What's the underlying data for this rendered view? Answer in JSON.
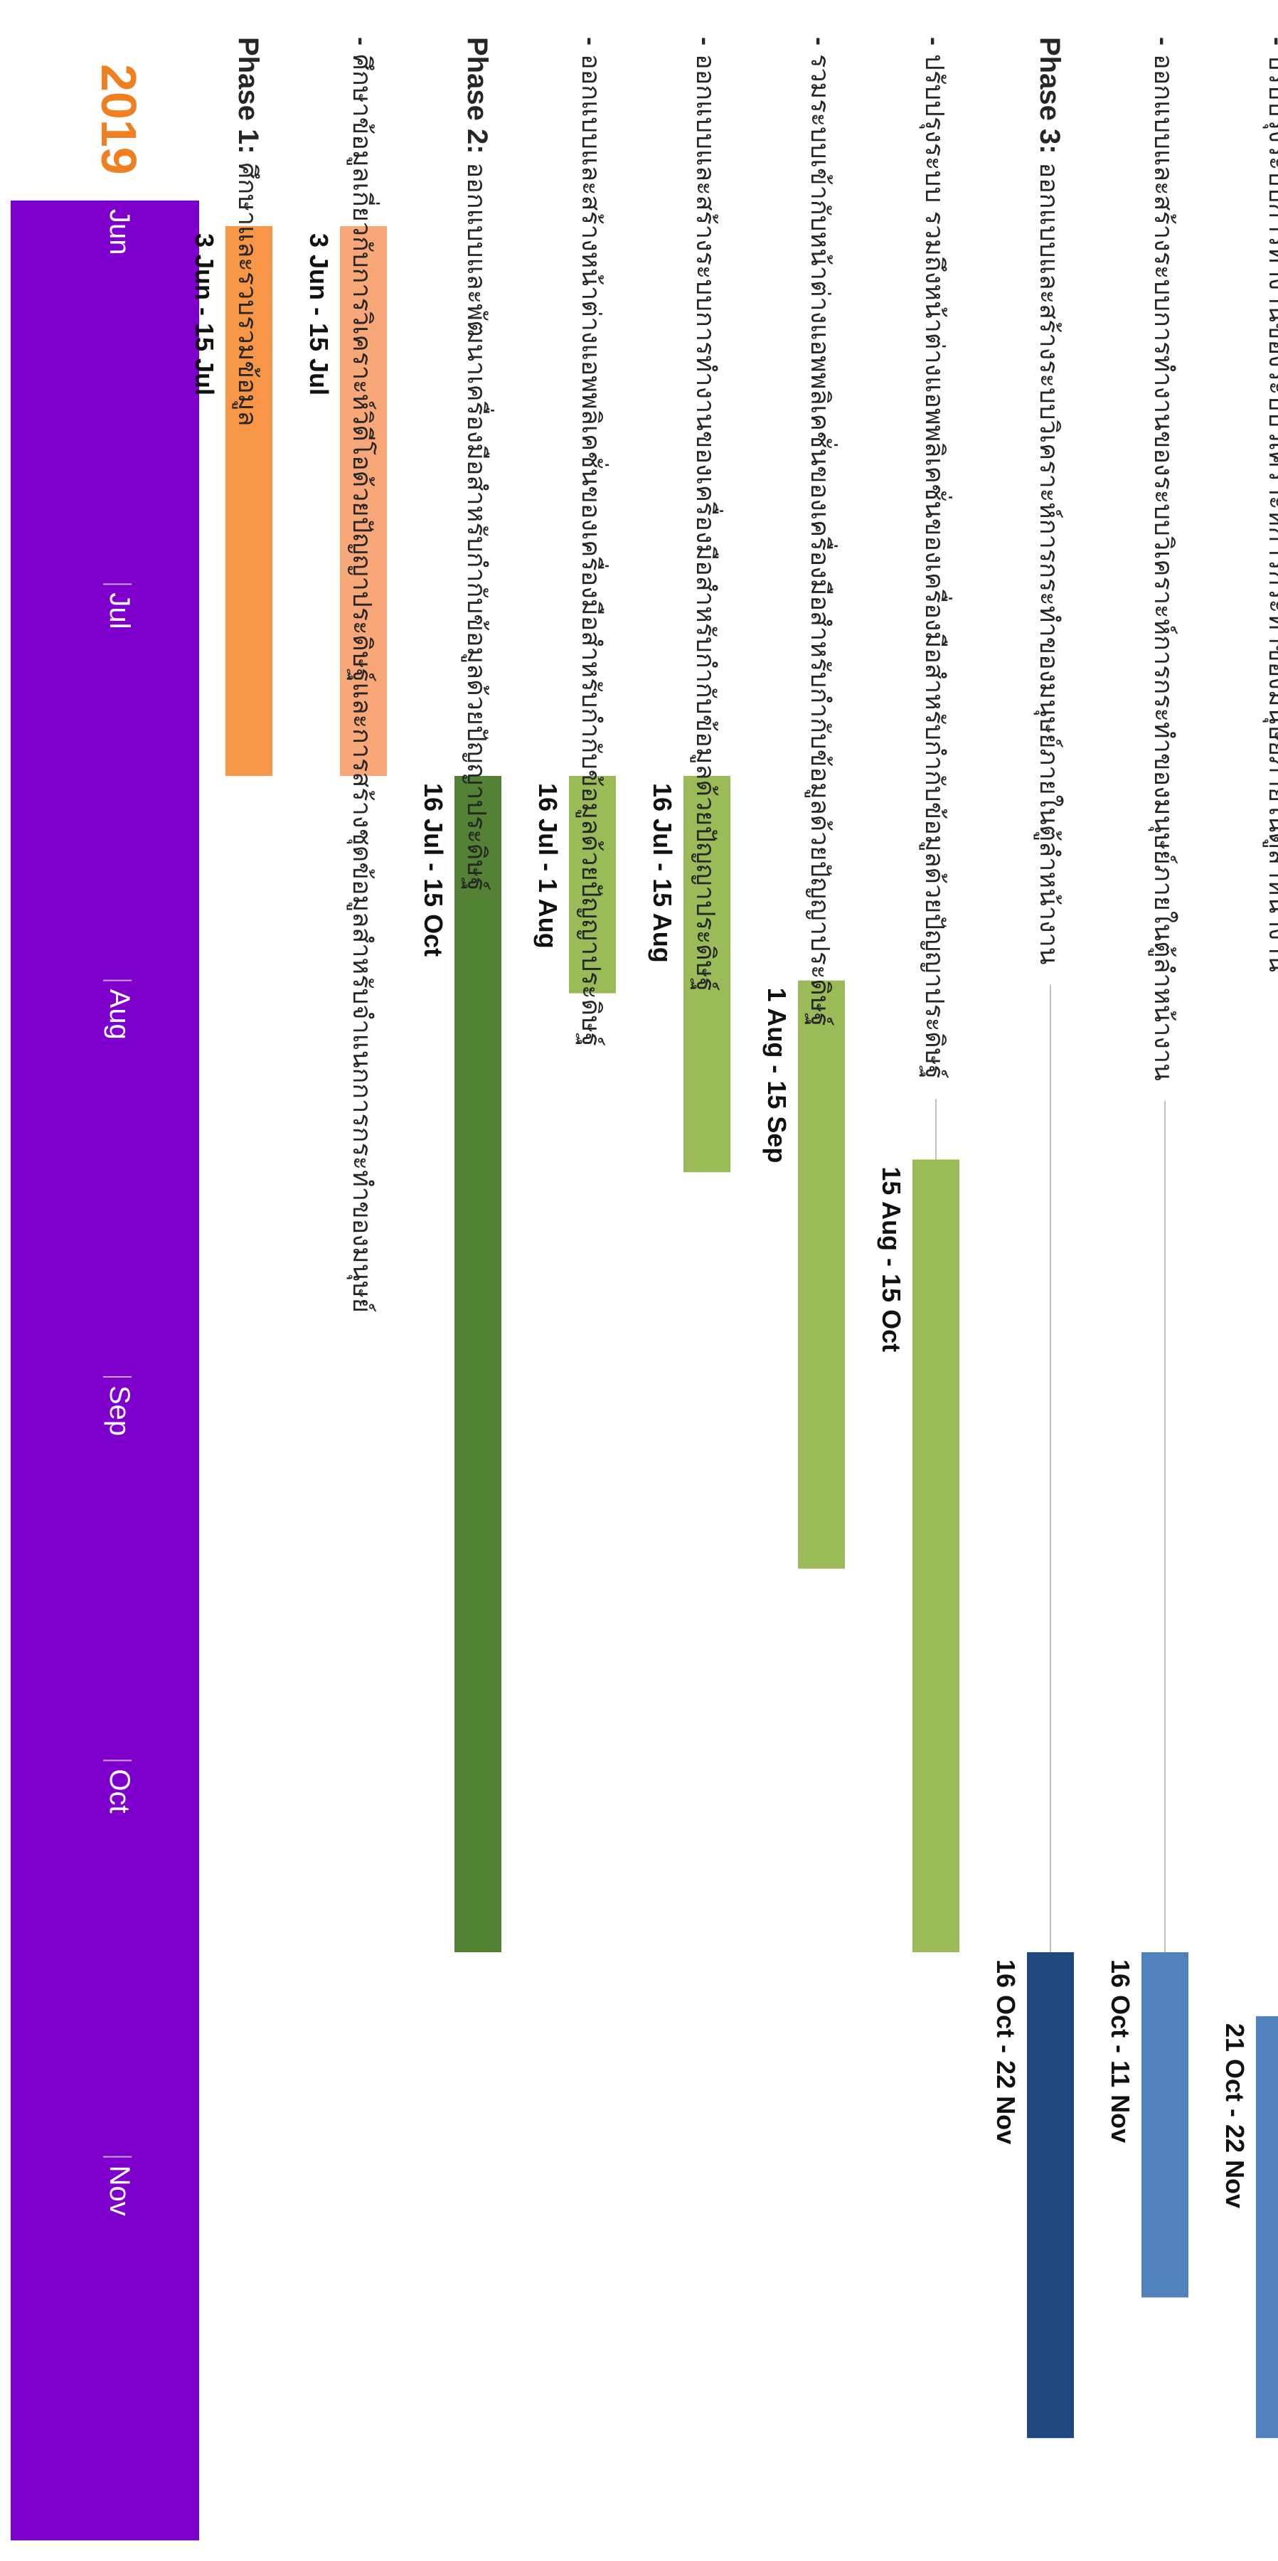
{
  "chart_data": {
    "type": "gantt",
    "year": "2019",
    "months": [
      "Jun",
      "Jul",
      "Aug",
      "Sep",
      "Oct",
      "Nov"
    ],
    "rows": [
      {
        "kind": "task",
        "title": "Phase 1:",
        "text": "ศึกษาและรวบรวมข้อมูล",
        "date_label": "3 Jun - 15 Jul",
        "start": "2019-06-03",
        "end": "2019-07-15",
        "color": "#F79646"
      },
      {
        "kind": "task",
        "title": "-",
        "text": "ศึกษาข้อมูลเกี่ยวกับการวิเคราะห์วิดีโอด้วยปัญญาประดิษฐ์และการสร้างชุดข้อมูลสำหรับจำแนกการกระทำของมนุษย์",
        "date_label": "3 Jun - 15 Jul",
        "start": "2019-06-03",
        "end": "2019-07-15",
        "color": "#F8A878"
      },
      {
        "kind": "task",
        "title": "Phase 2:",
        "text": "ออกแบบและพัฒนาเครื่องมือสำหรับกำกับข้อมูลด้วยปัญญาประดิษฐ์",
        "date_label": "16 Jul - 15 Oct",
        "start": "2019-07-16",
        "end": "2019-10-15",
        "color": "#548235"
      },
      {
        "kind": "task",
        "title": "-",
        "text": "ออกแบบและสร้างหน้าต่างแอพพลิเคชั่นของเครื่องมือสำหรับกำกับข้อมูลด้วยปัญญาประดิษฐ์",
        "date_label": "16 Jul - 1 Aug",
        "start": "2019-07-16",
        "end": "2019-08-01",
        "color": "#9BBB59"
      },
      {
        "kind": "task",
        "title": "-",
        "text": "ออกแบบและสร้างระบบการทำงานของเครื่องมือสำหรับกำกับข้อมูลด้วยปัญญาประดิษฐ์",
        "date_label": "16 Jul - 15 Aug",
        "start": "2019-07-16",
        "end": "2019-08-15",
        "color": "#9BBB59"
      },
      {
        "kind": "task",
        "title": "-",
        "text": "รวมระบบเข้ากับหน้าต่างแอพพลิเคชั่นของเครื่องมือสำหรับกำกับข้อมูลด้วยปัญญาประดิษฐ์",
        "date_label": "1 Aug - 15 Sep",
        "start": "2019-08-01",
        "end": "2019-09-15",
        "color": "#9BBB59"
      },
      {
        "kind": "task",
        "title": "-",
        "text": "ปรับปรุงระบบ รวมถึงหน้าต่างแอพพลิเคชั่นของเครื่องมือสำหรับกำกับข้อมูลด้วยปัญญาประดิษฐ์",
        "date_label": "15 Aug - 15 Oct",
        "start": "2019-08-15",
        "end": "2019-10-15",
        "color": "#9BBB59"
      },
      {
        "kind": "task",
        "title": "Phase 3:",
        "text": "ออกแบบและสร้างระบบวิเคราะห์การกระทำของมนุษย์ภายในตู้ลำหน้างาน",
        "date_label": "16 Oct - 22 Nov",
        "start": "2019-10-16",
        "end": "2019-11-22",
        "color": "#1F497D"
      },
      {
        "kind": "task",
        "title": "-",
        "text": "ออกแบบและสร้างระบบการทำงานของระบบวิเคราะห์การกระทำของมนุษย์ภายในตู้ลำหน้างาน",
        "date_label": "16 Oct - 11 Nov",
        "start": "2019-10-16",
        "end": "2019-11-11",
        "color": "#4F81BD"
      },
      {
        "kind": "task",
        "title": "-",
        "text": "ปรับปรุงระบบการทำงานของระบบวิเคราะห์การกระทำของมนุษย์ภายในตู้ลำหน้างาน",
        "date_label": "21 Oct - 22 Nov",
        "start": "2019-10-21",
        "end": "2019-11-22",
        "color": "#4F81BD"
      }
    ],
    "colors": {
      "timescale_band": "#7F00CC",
      "year": "#F07F22",
      "month_text": "#FFFFFF",
      "leader_line": "#BFBFBF",
      "task_text": "#262626",
      "date_text": "#111111"
    }
  }
}
